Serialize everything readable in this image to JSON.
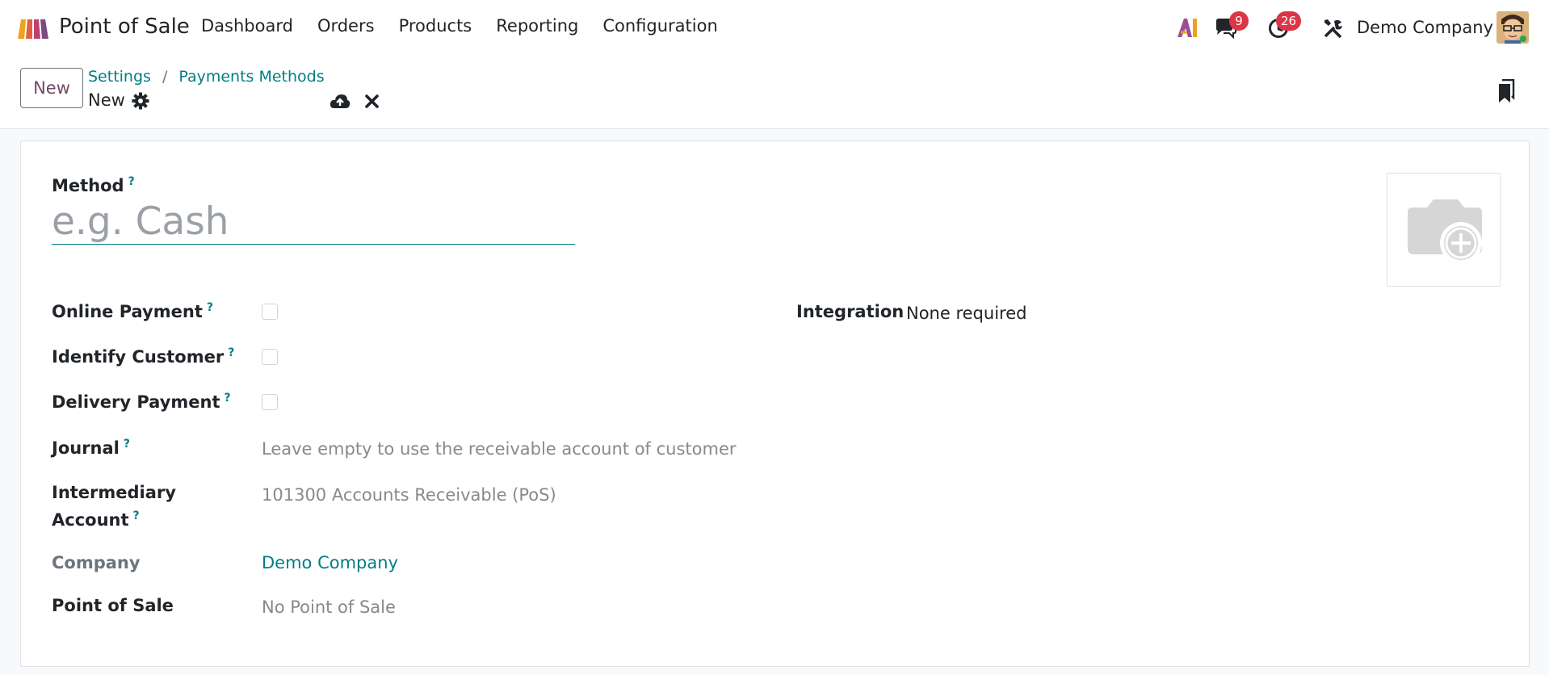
{
  "navbar": {
    "app_name": "Point of Sale",
    "menu": [
      "Dashboard",
      "Orders",
      "Products",
      "Reporting",
      "Configuration"
    ],
    "chat_badge": "9",
    "activity_badge": "26",
    "company": "Demo Company"
  },
  "control_panel": {
    "new_label": "New",
    "breadcrumb": [
      "Settings",
      "Payments Methods"
    ],
    "breadcrumb_separator": "/",
    "record_name": "New"
  },
  "form": {
    "method_label": "Method",
    "method_placeholder": "e.g. Cash",
    "help_mark": "?",
    "fields": {
      "online_payment": {
        "label": "Online Payment",
        "checked": false
      },
      "identify_customer": {
        "label": "Identify Customer",
        "checked": false
      },
      "delivery_payment": {
        "label": "Delivery Payment",
        "checked": false
      },
      "journal": {
        "label": "Journal",
        "placeholder": "Leave empty to use the receivable account of customer"
      },
      "intermediary_account": {
        "label_line1": "Intermediary",
        "label_line2": "Account",
        "value": "101300 Accounts Receivable (PoS)"
      },
      "company": {
        "label": "Company",
        "value": "Demo Company"
      },
      "point_of_sale": {
        "label": "Point of Sale",
        "value": "No Point of Sale"
      },
      "integration": {
        "label": "Integration",
        "value": "None required"
      }
    }
  },
  "colors": {
    "accent": "#017e84",
    "brand": "#714b67",
    "badge": "#dc3545"
  }
}
